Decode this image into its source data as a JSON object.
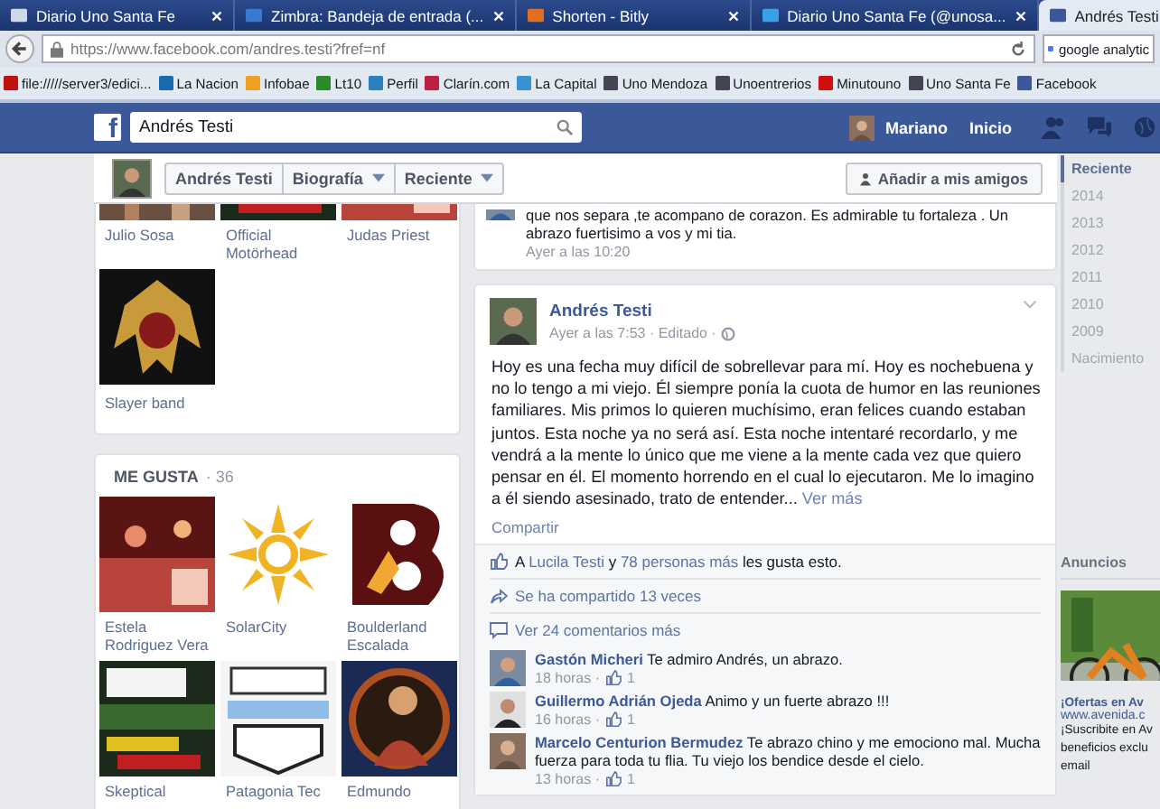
{
  "browser": {
    "tabs": [
      {
        "title": "Diario Uno Santa Fe",
        "selected": false
      },
      {
        "title": "Zimbra: Bandeja de entrada (...",
        "selected": false
      },
      {
        "title": "Shorten - Bitly",
        "selected": false
      },
      {
        "title": "Diario Uno Santa Fe (@unosa...",
        "selected": false
      },
      {
        "title": "Andrés Testi",
        "selected": true
      }
    ],
    "address": "https://www.facebook.com/andres.testi?fref=nf",
    "search": "google analytic",
    "bookmarks": [
      "file://///server3/edici...",
      "La Nacion",
      "Infobae",
      "Lt10",
      "Perfil",
      "Clarín.com",
      "La Capital",
      "Uno Mendoza",
      "Unoentrerios",
      "Minutouno",
      "Uno Santa Fe",
      "Facebook"
    ]
  },
  "header": {
    "logo": "f",
    "search": "Andrés Testi",
    "user": "Mariano",
    "home": "Inicio"
  },
  "profile_bar": {
    "name": "Andrés Testi",
    "menus": [
      "Biografía",
      "Reciente"
    ],
    "add_friend": "Añadir a mis amigos"
  },
  "pages_card": {
    "cut_items": [
      "Julio Sosa",
      "Official Motörhead",
      "Judas Priest"
    ],
    "items": [
      "Slayer band"
    ]
  },
  "likes_card": {
    "title": "ME GUSTA",
    "count": "· 36",
    "items": [
      "Estela Rodriguez Vera",
      "SolarCity",
      "Boulderland Escalada",
      "Skeptical",
      "Patagonia Tec",
      "Edmundo"
    ]
  },
  "previous_post": {
    "text": "que nos separa ,te acompano de corazon. Es admirable tu fortaleza . Un abrazo fuertisimo a vos y mi tia.",
    "time": "Ayer a las 10:20"
  },
  "post": {
    "author": "Andrés Testi",
    "time": "Ayer a las 7:53 · Editado ·",
    "text": "Hoy es una fecha muy difícil de sobrellevar para mí. Hoy es nochebuena y no lo tengo a mi viejo. Él siempre ponía la cuota de humor en las reuniones familiares. Mis primos lo quieren muchísimo, eran felices cuando estaban juntos. Esta noche ya no será así. Esta noche intentaré recordarlo, y me vendrá a la mente lo único que me viene a la mente cada vez que quiero pensar en él. El momento horrendo en el cual lo ejecutaron. Me lo imagino a él siendo asesinado, trato de entender...",
    "more": "Ver más",
    "share": "Compartir",
    "likes": {
      "prefix": "A",
      "friend": "Lucila Testi",
      "join": "y",
      "others": "78 personas más",
      "suffix": "les gusta esto."
    },
    "shared": "Se ha compartido 13 veces",
    "more_comments": "Ver 24 comentarios más",
    "comments": [
      {
        "author": "Gastón Micheri",
        "text": "Te admiro Andrés, un abrazo.",
        "time": "18 horas ·",
        "likes": "1"
      },
      {
        "author": "Guillermo Adrián Ojeda",
        "text": "Animo y un fuerte abrazo !!!",
        "time": "16 horas ·",
        "likes": "1"
      },
      {
        "author": "Marcelo Centurion Bermudez",
        "text": "Te abrazo chino y me emociono mal. Mucha fuerza para toda tu flia. Tu viejo los bendice desde el cielo.",
        "time": "13 horas ·",
        "likes": "1"
      }
    ]
  },
  "timeline": [
    {
      "label": "Reciente",
      "selected": true
    },
    {
      "label": "2014",
      "selected": false
    },
    {
      "label": "2013",
      "selected": false
    },
    {
      "label": "2012",
      "selected": false
    },
    {
      "label": "2011",
      "selected": false
    },
    {
      "label": "2010",
      "selected": false
    },
    {
      "label": "2009",
      "selected": false
    },
    {
      "label": "Nacimiento",
      "selected": false
    }
  ],
  "ads": {
    "title": "Anuncios",
    "headline": "¡Ofertas en Av",
    "url": "www.avenida.c",
    "lines": [
      "¡Suscribite en Av",
      "beneficios exclu",
      "email"
    ]
  }
}
